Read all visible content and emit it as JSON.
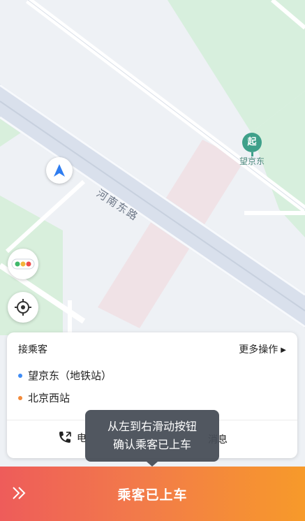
{
  "map": {
    "road_name": "河南东路",
    "poi_marker": "起",
    "poi_label": "望京东"
  },
  "card": {
    "title": "接乘客",
    "more_actions": "更多操作",
    "pickup": "望京东（地铁站）",
    "dropoff": "北京西站",
    "call_label": "电",
    "message_label": "消息",
    "pickup_color": "#3f8cf5",
    "dropoff_color": "#f28a3a"
  },
  "tooltip": {
    "line1": "从左到右滑动按钮",
    "line2": "确认乘客已上车"
  },
  "slider": {
    "label": "乘客已上车",
    "handle_icon": "double-chevron-right-icon"
  }
}
